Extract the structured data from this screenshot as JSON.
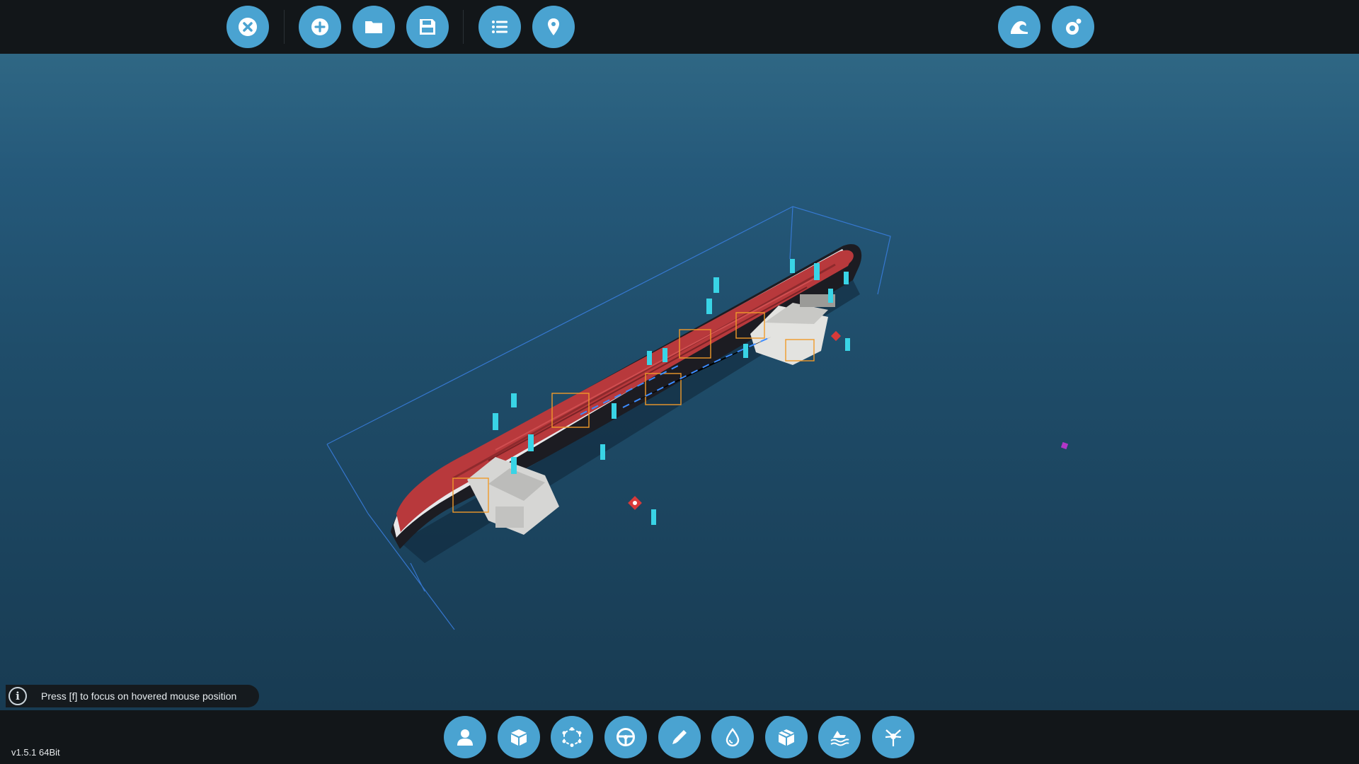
{
  "toolbar_top": {
    "left_buttons": [
      {
        "icon": "close-icon"
      },
      {
        "icon": "add-icon"
      },
      {
        "icon": "folder-icon"
      },
      {
        "icon": "save-icon"
      },
      {
        "icon": "list-icon"
      },
      {
        "icon": "map-pin-icon"
      }
    ],
    "right_buttons": [
      {
        "icon": "wave-icon"
      },
      {
        "icon": "orbit-icon"
      }
    ]
  },
  "toolbar_bottom": {
    "buttons": [
      {
        "icon": "person-icon"
      },
      {
        "icon": "cube-icon"
      },
      {
        "icon": "transform-icon"
      },
      {
        "icon": "steering-wheel-icon"
      },
      {
        "icon": "pencil-icon"
      },
      {
        "icon": "water-drop-icon"
      },
      {
        "icon": "cargo-box-icon"
      },
      {
        "icon": "ship-waves-icon"
      },
      {
        "icon": "anchor-point-icon"
      }
    ]
  },
  "info": {
    "message": "Press [f] to focus on hovered mouse position"
  },
  "version": "v1.5.1 64Bit",
  "colors": {
    "button_fill": "#4aa3d1",
    "toolbar_bg": "#121619",
    "ocean": "#1f4d6a",
    "hull_red": "#b8393c"
  }
}
